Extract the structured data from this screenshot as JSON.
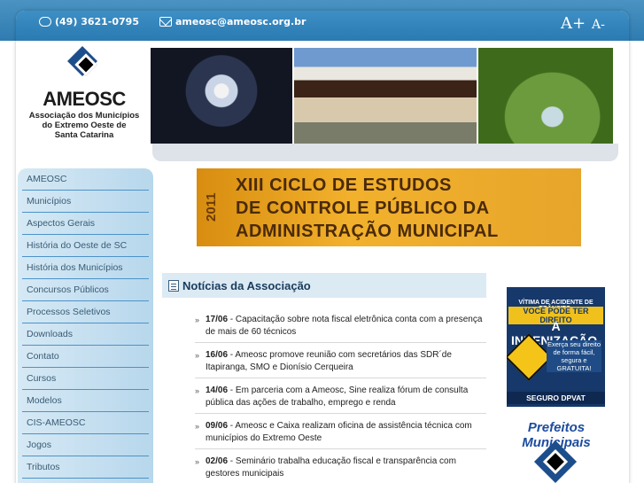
{
  "header": {
    "phone": "(49) 3621-0795",
    "email": "ameosc@ameosc.org.br",
    "font_increase": "A+",
    "font_decrease": "A-"
  },
  "logo": {
    "name": "AMEOSC",
    "subtitle": [
      "Associação dos Municípios",
      "do Extremo Oeste de",
      "Santa Catarina"
    ]
  },
  "nav": {
    "items": [
      {
        "label": "AMEOSC"
      },
      {
        "label": "Municípios"
      },
      {
        "label": "Aspectos Gerais"
      },
      {
        "label": "História do Oeste de SC"
      },
      {
        "label": "História dos Municípios"
      },
      {
        "label": "Concursos Públicos"
      },
      {
        "label": "Processos Seletivos"
      },
      {
        "label": "Downloads"
      },
      {
        "label": "Contato"
      },
      {
        "label": "Cursos"
      },
      {
        "label": "Modelos"
      },
      {
        "label": "CIS-AMEOSC"
      },
      {
        "label": "Jogos"
      },
      {
        "label": "Tributos"
      }
    ]
  },
  "banner": {
    "year": "2011",
    "lines": [
      "XIII CICLO DE ESTUDOS",
      "DE CONTROLE PÚBLICO DA",
      "ADMINISTRAÇÃO MUNICIPAL"
    ]
  },
  "news": {
    "title": "Notícias da Associação",
    "items": [
      {
        "date": "17/06",
        "text": " - Capacitação sobre nota fiscal eletrônica conta com a presença de mais de 60 técnicos"
      },
      {
        "date": "16/06",
        "text": " - Ameosc promove reunião com secretários das SDR´de Itapiranga, SMO e Dionísio Cerqueira"
      },
      {
        "date": "14/06",
        "text": " - Em parceria com a Ameosc, Sine realiza fórum de consulta pública das ações de trabalho, emprego e renda"
      },
      {
        "date": "09/06",
        "text": " - Ameosc e Caixa realizam oficina de assistência técnica com municípios do Extremo Oeste"
      },
      {
        "date": "02/06",
        "text": " - Seminário trabalha educação fiscal e transparência com gestores municipais"
      }
    ]
  },
  "ads": {
    "dpvat": {
      "line1": "VÍTIMA DE ACIDENTE DE TRÂNSITO:",
      "line2": "VOCÊ PODE TER DIREITO",
      "line3": "A INDENIZAÇÃO.",
      "line4": "Exerça seu direito de forma fácil, segura e GRATUITA!",
      "footer": "SEGURO DPVAT"
    },
    "prefeitos": {
      "title": "Prefeitos Municipais"
    }
  }
}
